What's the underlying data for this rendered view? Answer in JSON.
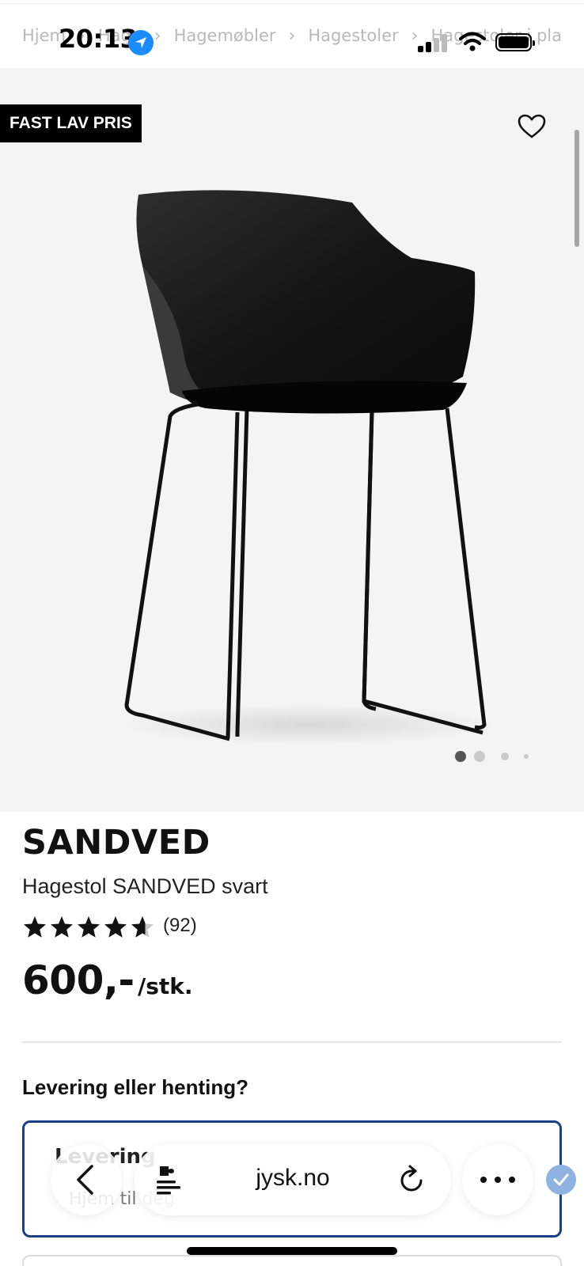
{
  "status_bar": {
    "time": "20:13",
    "icons": [
      "location-arrow-icon",
      "signal-icon",
      "wifi-icon",
      "battery-icon"
    ]
  },
  "breadcrumb": {
    "items": [
      "Hjem",
      "Hage",
      "Hagemøbler",
      "Hagestoler",
      "Hagestoler i pla"
    ]
  },
  "gallery": {
    "badge": "FAST LAV PRIS",
    "favorite_icon": "heart-icon",
    "image": "chair-product-image",
    "page_dots": 4,
    "active_dot": 1
  },
  "product": {
    "name": "SANDVED",
    "subtitle": "Hagestol SANDVED svart",
    "rating": 4.5,
    "reviews": "(92)",
    "price": "600,-",
    "unit": "/stk."
  },
  "delivery": {
    "question": "Levering eller henting?",
    "option_label": "Levering",
    "option_sub": "Hjem til deg"
  },
  "safari": {
    "url": "jysk.no",
    "icons": [
      "back-icon",
      "extension-icon",
      "reload-icon",
      "more-icon",
      "checkmark-icon"
    ]
  },
  "colors": {
    "accent": "#1c3e85",
    "badge_bg": "#000000",
    "gallery_bg": "#f4f4f4",
    "location": "#1a8cff"
  }
}
